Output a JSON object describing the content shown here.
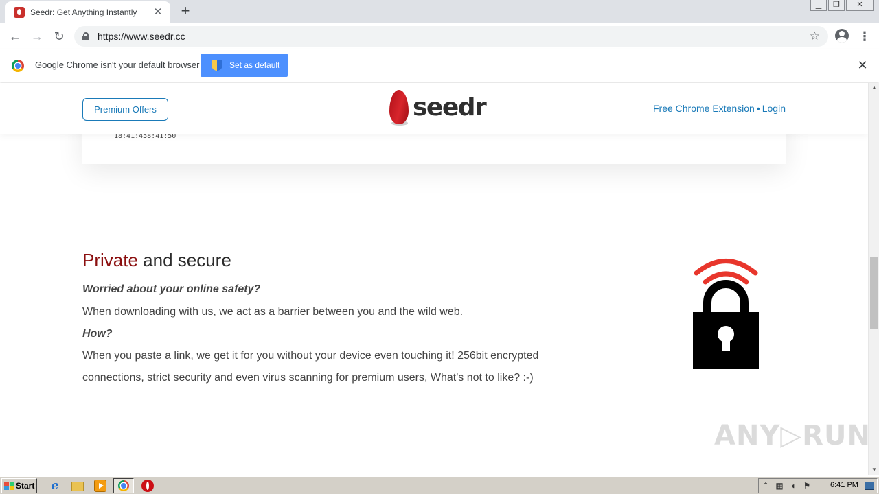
{
  "browser": {
    "tab": {
      "title": "Seedr: Get Anything Instantly",
      "close_glyph": "✕"
    },
    "new_tab_glyph": "+",
    "window_controls": {
      "minimize": "▁",
      "restore": "❐",
      "close": "✕"
    },
    "nav": {
      "back": "←",
      "forward": "→",
      "reload": "↻"
    },
    "address": {
      "url": "https://www.seedr.cc",
      "star_glyph": "☆"
    },
    "menu_glyph": "⋮",
    "infobar": {
      "message": "Google Chrome isn't your default browser",
      "button_label": "Set as default",
      "close_glyph": "✕"
    }
  },
  "site": {
    "header": {
      "premium_label": "Premium Offers",
      "logo_text": "seedr",
      "extension_link": "Free Chrome Extension",
      "separator": "•",
      "login_link": "Login"
    },
    "card": {
      "time_text": "18:41:458:41:50"
    },
    "section": {
      "title_accent": "Private",
      "title_rest": " and secure",
      "question": "Worried about your online safety?",
      "paragraph1": "When downloading with us, we act as a barrier between you and the wild web.",
      "how": "How?",
      "paragraph2": "When you paste a link, we get it for you without your device even touching it! 256bit encrypted connections, strict security and even virus scanning for premium users, What's not to like? :-)"
    },
    "colors": {
      "accent_red": "#8b0f0f",
      "link_blue": "#1a7ab8",
      "lock_wave_red": "#e8362c"
    }
  },
  "watermark": "ANY▷RUN",
  "scrollbar": {
    "up": "▲",
    "down": "▼"
  },
  "taskbar": {
    "start_label": "Start",
    "clock": "6:41 PM",
    "tray_icons": [
      "show-hidden-icon",
      "network-icon",
      "volume-icon",
      "flag-icon"
    ]
  }
}
